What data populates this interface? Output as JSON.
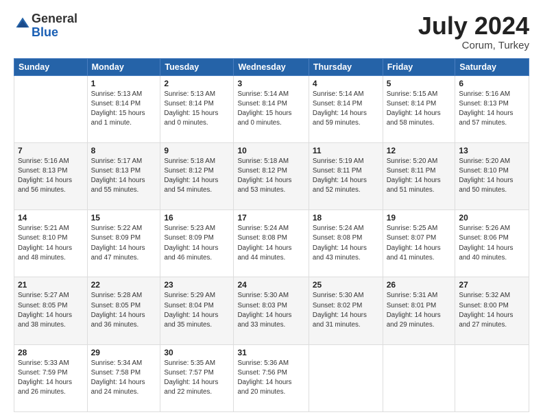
{
  "header": {
    "logo": {
      "line1": "General",
      "line2": "Blue"
    },
    "title": "July 2024",
    "location": "Corum, Turkey"
  },
  "calendar": {
    "days_of_week": [
      "Sunday",
      "Monday",
      "Tuesday",
      "Wednesday",
      "Thursday",
      "Friday",
      "Saturday"
    ],
    "weeks": [
      [
        {
          "day": "",
          "info": ""
        },
        {
          "day": "1",
          "info": "Sunrise: 5:13 AM\nSunset: 8:14 PM\nDaylight: 15 hours\nand 1 minute."
        },
        {
          "day": "2",
          "info": "Sunrise: 5:13 AM\nSunset: 8:14 PM\nDaylight: 15 hours\nand 0 minutes."
        },
        {
          "day": "3",
          "info": "Sunrise: 5:14 AM\nSunset: 8:14 PM\nDaylight: 15 hours\nand 0 minutes."
        },
        {
          "day": "4",
          "info": "Sunrise: 5:14 AM\nSunset: 8:14 PM\nDaylight: 14 hours\nand 59 minutes."
        },
        {
          "day": "5",
          "info": "Sunrise: 5:15 AM\nSunset: 8:14 PM\nDaylight: 14 hours\nand 58 minutes."
        },
        {
          "day": "6",
          "info": "Sunrise: 5:16 AM\nSunset: 8:13 PM\nDaylight: 14 hours\nand 57 minutes."
        }
      ],
      [
        {
          "day": "7",
          "info": "Sunrise: 5:16 AM\nSunset: 8:13 PM\nDaylight: 14 hours\nand 56 minutes."
        },
        {
          "day": "8",
          "info": "Sunrise: 5:17 AM\nSunset: 8:13 PM\nDaylight: 14 hours\nand 55 minutes."
        },
        {
          "day": "9",
          "info": "Sunrise: 5:18 AM\nSunset: 8:12 PM\nDaylight: 14 hours\nand 54 minutes."
        },
        {
          "day": "10",
          "info": "Sunrise: 5:18 AM\nSunset: 8:12 PM\nDaylight: 14 hours\nand 53 minutes."
        },
        {
          "day": "11",
          "info": "Sunrise: 5:19 AM\nSunset: 8:11 PM\nDaylight: 14 hours\nand 52 minutes."
        },
        {
          "day": "12",
          "info": "Sunrise: 5:20 AM\nSunset: 8:11 PM\nDaylight: 14 hours\nand 51 minutes."
        },
        {
          "day": "13",
          "info": "Sunrise: 5:20 AM\nSunset: 8:10 PM\nDaylight: 14 hours\nand 50 minutes."
        }
      ],
      [
        {
          "day": "14",
          "info": "Sunrise: 5:21 AM\nSunset: 8:10 PM\nDaylight: 14 hours\nand 48 minutes."
        },
        {
          "day": "15",
          "info": "Sunrise: 5:22 AM\nSunset: 8:09 PM\nDaylight: 14 hours\nand 47 minutes."
        },
        {
          "day": "16",
          "info": "Sunrise: 5:23 AM\nSunset: 8:09 PM\nDaylight: 14 hours\nand 46 minutes."
        },
        {
          "day": "17",
          "info": "Sunrise: 5:24 AM\nSunset: 8:08 PM\nDaylight: 14 hours\nand 44 minutes."
        },
        {
          "day": "18",
          "info": "Sunrise: 5:24 AM\nSunset: 8:08 PM\nDaylight: 14 hours\nand 43 minutes."
        },
        {
          "day": "19",
          "info": "Sunrise: 5:25 AM\nSunset: 8:07 PM\nDaylight: 14 hours\nand 41 minutes."
        },
        {
          "day": "20",
          "info": "Sunrise: 5:26 AM\nSunset: 8:06 PM\nDaylight: 14 hours\nand 40 minutes."
        }
      ],
      [
        {
          "day": "21",
          "info": "Sunrise: 5:27 AM\nSunset: 8:05 PM\nDaylight: 14 hours\nand 38 minutes."
        },
        {
          "day": "22",
          "info": "Sunrise: 5:28 AM\nSunset: 8:05 PM\nDaylight: 14 hours\nand 36 minutes."
        },
        {
          "day": "23",
          "info": "Sunrise: 5:29 AM\nSunset: 8:04 PM\nDaylight: 14 hours\nand 35 minutes."
        },
        {
          "day": "24",
          "info": "Sunrise: 5:30 AM\nSunset: 8:03 PM\nDaylight: 14 hours\nand 33 minutes."
        },
        {
          "day": "25",
          "info": "Sunrise: 5:30 AM\nSunset: 8:02 PM\nDaylight: 14 hours\nand 31 minutes."
        },
        {
          "day": "26",
          "info": "Sunrise: 5:31 AM\nSunset: 8:01 PM\nDaylight: 14 hours\nand 29 minutes."
        },
        {
          "day": "27",
          "info": "Sunrise: 5:32 AM\nSunset: 8:00 PM\nDaylight: 14 hours\nand 27 minutes."
        }
      ],
      [
        {
          "day": "28",
          "info": "Sunrise: 5:33 AM\nSunset: 7:59 PM\nDaylight: 14 hours\nand 26 minutes."
        },
        {
          "day": "29",
          "info": "Sunrise: 5:34 AM\nSunset: 7:58 PM\nDaylight: 14 hours\nand 24 minutes."
        },
        {
          "day": "30",
          "info": "Sunrise: 5:35 AM\nSunset: 7:57 PM\nDaylight: 14 hours\nand 22 minutes."
        },
        {
          "day": "31",
          "info": "Sunrise: 5:36 AM\nSunset: 7:56 PM\nDaylight: 14 hours\nand 20 minutes."
        },
        {
          "day": "",
          "info": ""
        },
        {
          "day": "",
          "info": ""
        },
        {
          "day": "",
          "info": ""
        }
      ]
    ]
  }
}
